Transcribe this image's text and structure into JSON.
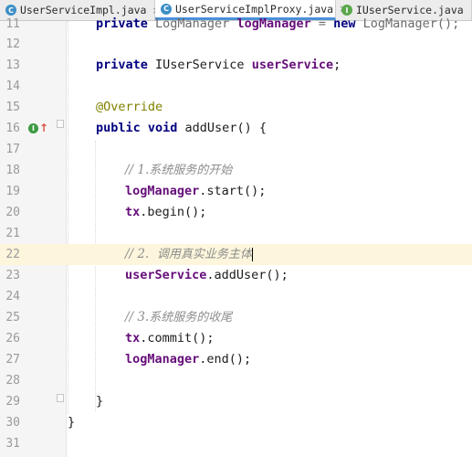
{
  "tabs": [
    {
      "label": "UserServiceImpl.java",
      "icon": "class-icon",
      "letter": "C",
      "active": false
    },
    {
      "label": "UserServiceImplProxy.java",
      "icon": "class-icon",
      "letter": "C",
      "active": true
    },
    {
      "label": "IUserService.java",
      "icon": "interface-icon",
      "letter": "I",
      "active": false
    }
  ],
  "close_glyph": "×",
  "gutter_icon": {
    "letter": "I",
    "arrow": "↑"
  },
  "lines": {
    "l11": {
      "num": "11",
      "a": "private ",
      "b": "LogManager ",
      "c": "logManager",
      "d": " = ",
      "e": "new ",
      "f": "LogManager();"
    },
    "l12": {
      "num": "12"
    },
    "l13": {
      "num": "13",
      "kw": "private ",
      "type": "IUserService ",
      "field": "userService",
      "tail": ";"
    },
    "l14": {
      "num": "14"
    },
    "l15": {
      "num": "15",
      "anno": "@Override"
    },
    "l16": {
      "num": "16",
      "kw": "public void ",
      "name": "addUser() {"
    },
    "l17": {
      "num": "17"
    },
    "l18": {
      "num": "18",
      "prefix": "// 1.",
      "cn": "系统服务的开始"
    },
    "l19": {
      "num": "19",
      "field": "logManager",
      "call": ".start();"
    },
    "l20": {
      "num": "20",
      "field": "tx",
      "call": ".begin();"
    },
    "l21": {
      "num": "21"
    },
    "l22": {
      "num": "22",
      "prefix": "// 2.  ",
      "cn": "调用真实业务主体"
    },
    "l23": {
      "num": "23",
      "field": "userService",
      "call": ".addUser();"
    },
    "l24": {
      "num": "24"
    },
    "l25": {
      "num": "25",
      "prefix": "// 3.",
      "cn": "系统服务的收尾"
    },
    "l26": {
      "num": "26",
      "field": "tx",
      "call": ".commit();"
    },
    "l27": {
      "num": "27",
      "field": "logManager",
      "call": ".end();"
    },
    "l28": {
      "num": "28"
    },
    "l29": {
      "num": "29",
      "text": "}"
    },
    "l30": {
      "num": "30",
      "text": "}"
    },
    "l31": {
      "num": "31"
    }
  },
  "colors": {
    "keyword": "#000080",
    "field": "#660e7a",
    "annotation": "#808000",
    "comment": "#8c8c8c",
    "current_line": "#fdf6dc",
    "tab_active_underline": "#4a90d9"
  }
}
